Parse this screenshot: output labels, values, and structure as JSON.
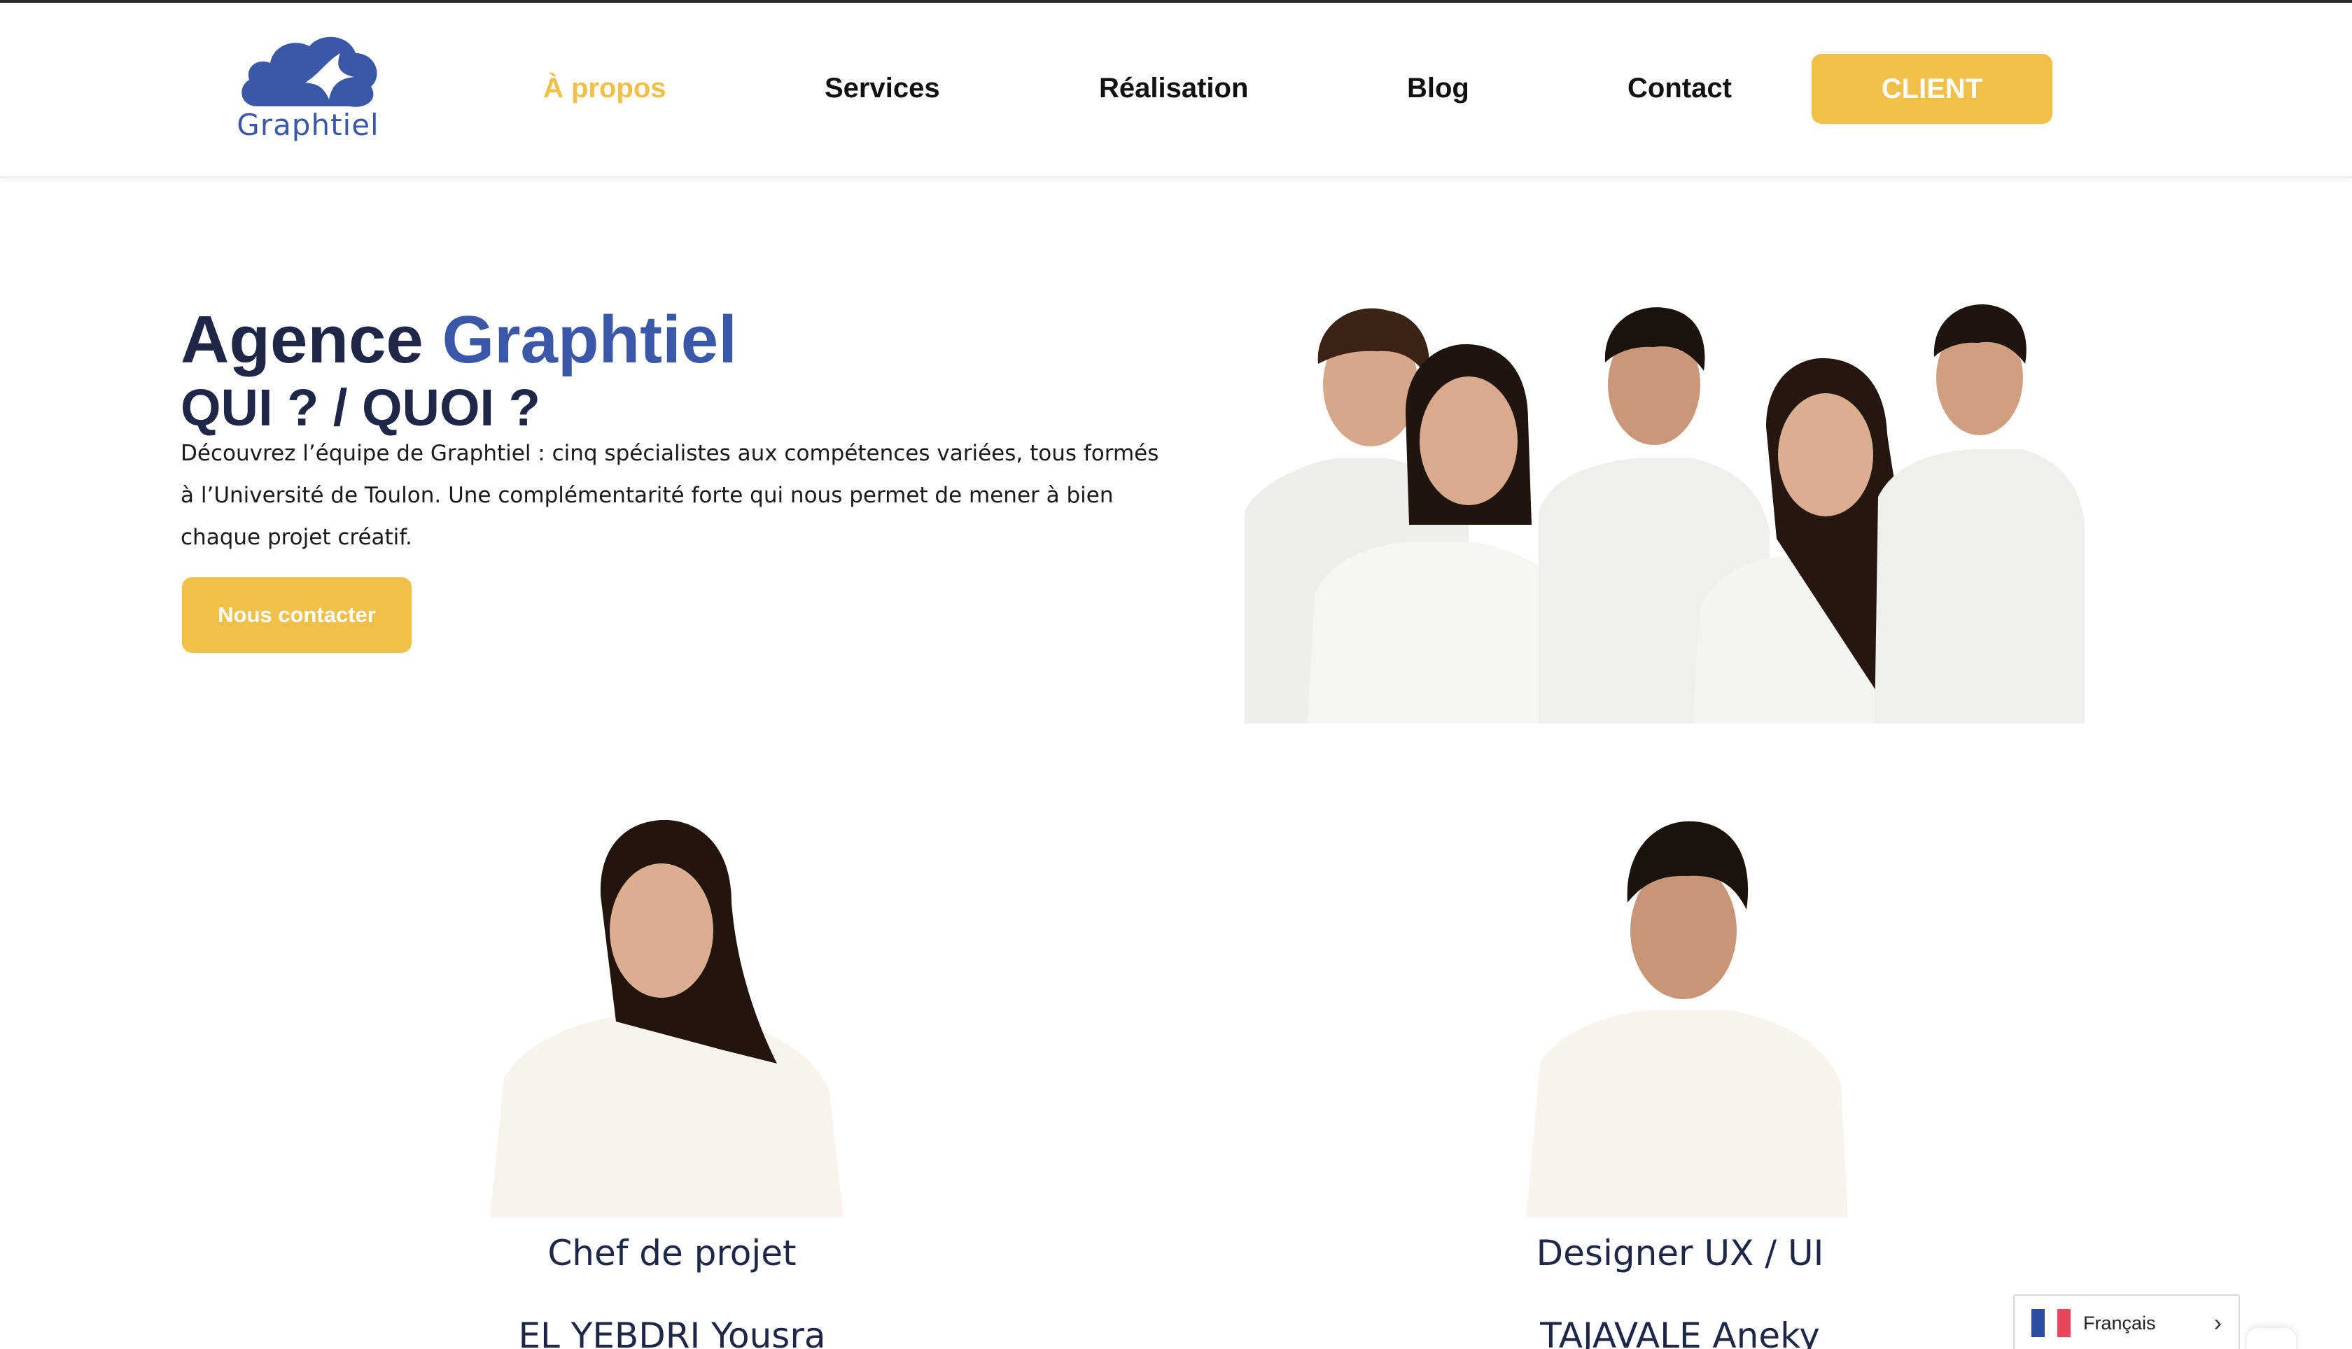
{
  "brand": {
    "name": "Graphtiel",
    "primary": "#3b58a8",
    "accent": "#f1c04a",
    "dark": "#1e2748"
  },
  "nav": {
    "items": [
      {
        "label": "À propos",
        "active": true
      },
      {
        "label": "Services",
        "active": false
      },
      {
        "label": "Réalisation",
        "active": false
      },
      {
        "label": "Blog",
        "active": false
      },
      {
        "label": "Contact",
        "active": false
      }
    ],
    "client_label": "CLIENT"
  },
  "hero": {
    "title_part1": "Agence",
    "title_part2": "Graphtiel",
    "subtitle": "QUI ? / QUOI ?",
    "description": "Découvrez l’équipe de Graphtiel : cinq spécialistes aux compétences variées, tous formés à l’Université de Toulon. Une complémentarité forte qui nous permet de mener à bien chaque projet créatif.",
    "cta_label": "Nous contacter",
    "group_photo_icon": "team-group-photo"
  },
  "team": [
    {
      "role": "Chef de projet",
      "name": "EL YEBDRI Yousra"
    },
    {
      "role": "Designer UX / UI",
      "name": "TAJAVALE Aneky"
    }
  ],
  "language": {
    "label": "Français",
    "icon": "france-flag-icon",
    "arrow_icon": "chevron-right-icon"
  }
}
